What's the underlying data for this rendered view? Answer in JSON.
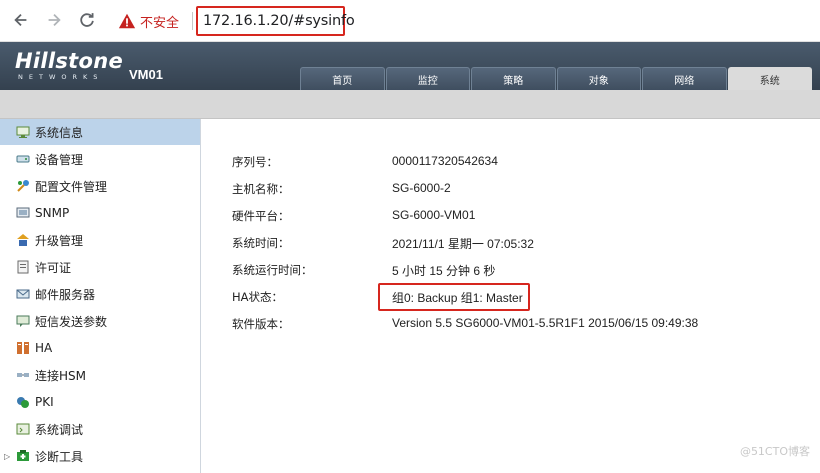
{
  "browser": {
    "security_label": "不安全",
    "url": "172.16.1.20/#sysinfo"
  },
  "header": {
    "logo_main": "Hillstone",
    "logo_sub": "NETWORKS",
    "device_name": "VM01",
    "tabs": [
      {
        "label": "首页"
      },
      {
        "label": "监控"
      },
      {
        "label": "策略"
      },
      {
        "label": "对象"
      },
      {
        "label": "网络"
      },
      {
        "label": "系统"
      }
    ],
    "active_tab": "系统"
  },
  "sidebar": {
    "items": [
      {
        "label": "系统信息",
        "icon": "monitor-icon"
      },
      {
        "label": "设备管理",
        "icon": "device-icon"
      },
      {
        "label": "配置文件管理",
        "icon": "config-icon"
      },
      {
        "label": "SNMP",
        "icon": "snmp-icon"
      },
      {
        "label": "升级管理",
        "icon": "upgrade-icon"
      },
      {
        "label": "许可证",
        "icon": "license-icon"
      },
      {
        "label": "邮件服务器",
        "icon": "mail-icon"
      },
      {
        "label": "短信发送参数",
        "icon": "sms-icon"
      },
      {
        "label": "HA",
        "icon": "ha-icon"
      },
      {
        "label": "连接HSM",
        "icon": "hsm-icon"
      },
      {
        "label": "PKI",
        "icon": "pki-icon"
      },
      {
        "label": "系统调试",
        "icon": "debug-icon"
      },
      {
        "label": "诊断工具",
        "icon": "diagnose-icon"
      }
    ],
    "active_item": "系统信息"
  },
  "sysinfo": {
    "rows": [
      {
        "label": "序列号：",
        "value": "0000117320542634"
      },
      {
        "label": "主机名称：",
        "value": "SG-6000-2"
      },
      {
        "label": "硬件平台：",
        "value": "SG-6000-VM01"
      },
      {
        "label": "系统时间：",
        "value": "2021/11/1 星期一 07:05:32"
      },
      {
        "label": "系统运行时间：",
        "value": "5 小时 15 分钟 6 秒"
      },
      {
        "label": "HA状态：",
        "value": "组0: Backup 组1: Master"
      },
      {
        "label": "软件版本：",
        "value": "Version 5.5 SG6000-VM01-5.5R1F1 2015/06/15 09:49:38"
      }
    ]
  },
  "watermark": "@51CTO博客",
  "colors": {
    "highlight_box": "#d6261e",
    "header_bg": "#3f4e5f",
    "active_sidebar": "#bcd3ea"
  }
}
